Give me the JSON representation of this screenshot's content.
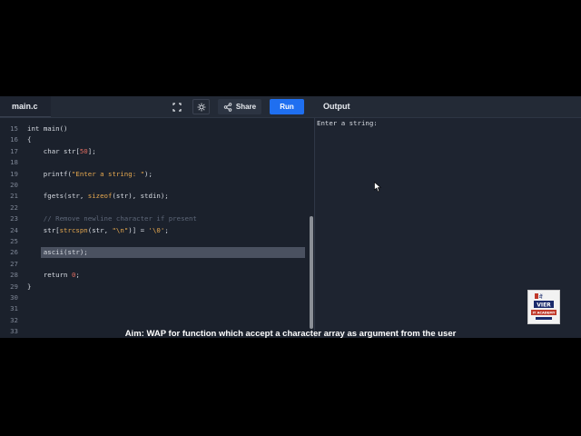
{
  "editor": {
    "filename": "main.c",
    "lines": [
      {
        "n": "15",
        "parts": [
          [
            "kw",
            "int "
          ],
          [
            "",
            "main()"
          ]
        ]
      },
      {
        "n": "16",
        "parts": [
          [
            "",
            "{"
          ]
        ]
      },
      {
        "n": "17",
        "parts": [
          [
            "",
            "    char str["
          ],
          [
            "numv",
            "50"
          ],
          [
            "",
            "];"
          ]
        ]
      },
      {
        "n": "18",
        "parts": []
      },
      {
        "n": "19",
        "parts": [
          [
            "",
            "    printf("
          ],
          [
            "str",
            "\"Enter a string: \""
          ],
          [
            "",
            ");"
          ]
        ]
      },
      {
        "n": "20",
        "parts": []
      },
      {
        "n": "21",
        "parts": [
          [
            "",
            "    fgets(str, "
          ],
          [
            "fn",
            "sizeof"
          ],
          [
            "",
            "(str), stdin);"
          ]
        ]
      },
      {
        "n": "22",
        "parts": []
      },
      {
        "n": "23",
        "parts": [
          [
            "comment",
            "    // Remove newline character if present"
          ]
        ]
      },
      {
        "n": "24",
        "parts": [
          [
            "",
            "    str["
          ],
          [
            "fn",
            "strcspn"
          ],
          [
            "",
            "(str, "
          ],
          [
            "str",
            "\"\\n\""
          ],
          [
            "",
            ")] = "
          ],
          [
            "str",
            "'\\0'"
          ],
          [
            "",
            ";"
          ]
        ]
      },
      {
        "n": "25",
        "parts": []
      },
      {
        "n": "26",
        "parts": [
          [
            "",
            "    ascii(str);"
          ]
        ],
        "highlight": true
      },
      {
        "n": "27",
        "parts": []
      },
      {
        "n": "28",
        "parts": [
          [
            "",
            "    return "
          ],
          [
            "numv",
            "0"
          ],
          [
            "",
            ";"
          ]
        ]
      },
      {
        "n": "29",
        "parts": [
          [
            "",
            "}"
          ]
        ]
      },
      {
        "n": "30",
        "parts": []
      },
      {
        "n": "31",
        "parts": []
      },
      {
        "n": "32",
        "parts": []
      },
      {
        "n": "33",
        "parts": []
      }
    ]
  },
  "toolbar": {
    "share_label": "Share",
    "run_label": "Run"
  },
  "output": {
    "title": "Output",
    "text": "Enter a string:"
  },
  "logo": {
    "top": "मैं",
    "middle": "VIER",
    "bottom": "IT ACADEMY"
  },
  "caption": "Aim: WAP  for function which accept a character array as argument from the user",
  "colors": {
    "run": "#1f6ff0",
    "background": "#1e2430",
    "editor": "#1b212c"
  }
}
